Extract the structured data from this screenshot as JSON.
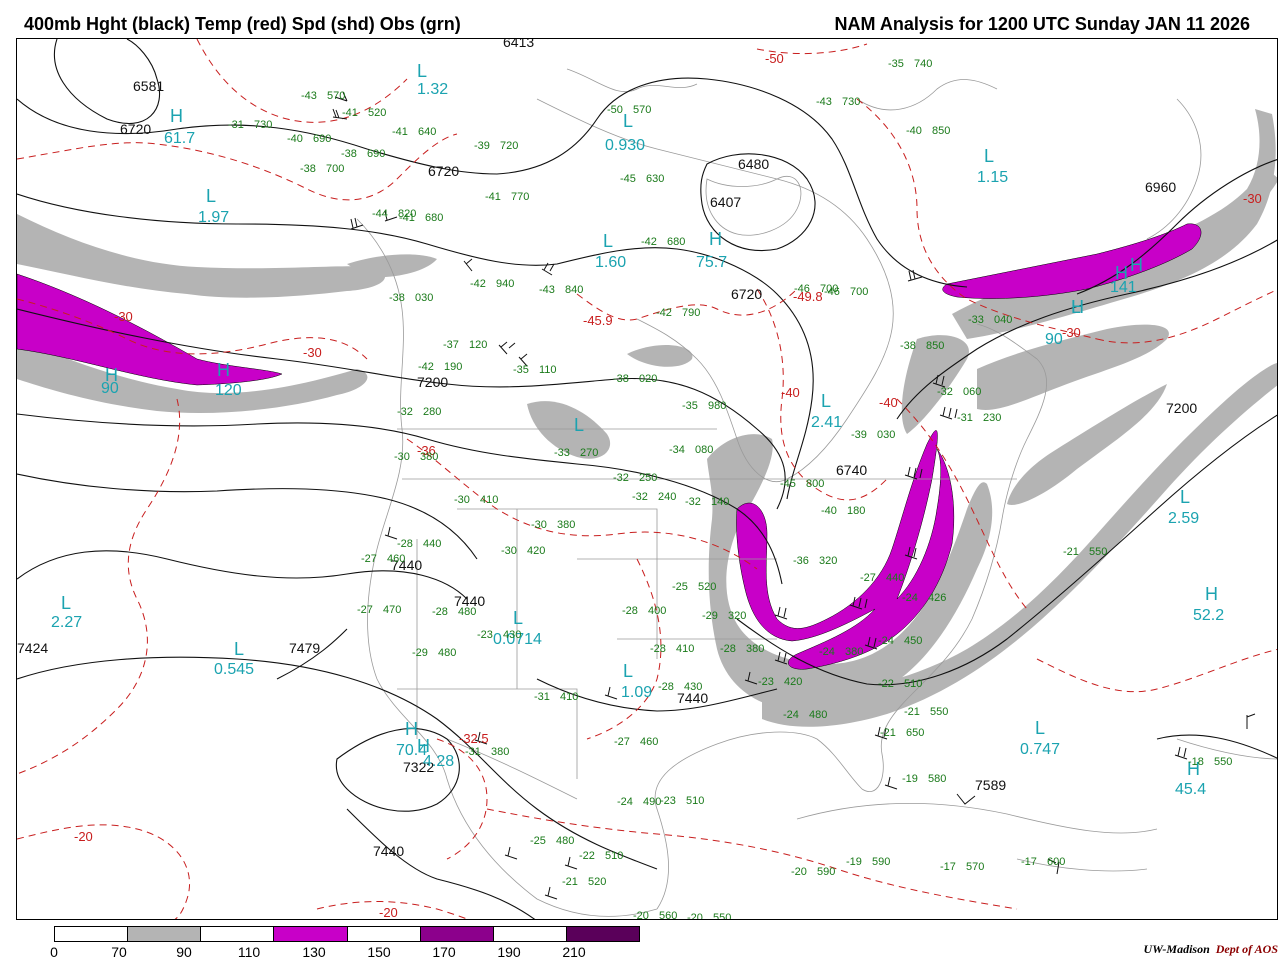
{
  "header": {
    "left_title": "400mb Hght (black) Temp (red) Spd (shd) Obs (grn)",
    "right_title": "NAM Analysis for 1200 UTC Sunday  JAN 11 2026"
  },
  "colors": {
    "height_contour": "#111111",
    "temp_contour": "#c81e1e",
    "obs": "#1a7a1a",
    "extrema": "#1ba3b0",
    "shade_70_90": "#b4b4b4",
    "shade_110_130": "#c800c8",
    "shade_150_170": "#8c008c",
    "shade_190_210": "#5a005a"
  },
  "height_labels": [
    {
      "text": "6413"
    },
    {
      "text": "6581"
    },
    {
      "text": "6720"
    },
    {
      "text": "6720"
    },
    {
      "text": "6480"
    },
    {
      "text": "6407"
    },
    {
      "text": "6720"
    },
    {
      "text": "6960"
    },
    {
      "text": "7200"
    },
    {
      "text": "7200"
    },
    {
      "text": "6740"
    },
    {
      "text": "7440"
    },
    {
      "text": "7440"
    },
    {
      "text": "7424"
    },
    {
      "text": "7479"
    },
    {
      "text": "7322"
    },
    {
      "text": "7440"
    },
    {
      "text": "7440"
    },
    {
      "text": "7589"
    }
  ],
  "temp_labels": [
    {
      "text": "-50"
    },
    {
      "text": "-30"
    },
    {
      "text": "-30"
    },
    {
      "text": "-30"
    },
    {
      "text": "-45.9"
    },
    {
      "text": "-49.8"
    },
    {
      "text": "-40"
    },
    {
      "text": "-40"
    },
    {
      "text": "-30"
    },
    {
      "text": "-36"
    },
    {
      "text": "-32.5"
    },
    {
      "text": "-20"
    },
    {
      "text": "-20"
    }
  ],
  "extrema": [
    {
      "letter": "L",
      "value": "1.32"
    },
    {
      "letter": "H",
      "value": "61.7"
    },
    {
      "letter": "L",
      "value": "1.97"
    },
    {
      "letter": "L",
      "value": "0.930"
    },
    {
      "letter": "L",
      "value": "1.15"
    },
    {
      "letter": "L",
      "value": "1.60"
    },
    {
      "letter": "H",
      "value": "75.7"
    },
    {
      "letter": "H",
      "value": "120"
    },
    {
      "letter": "H",
      "value": "90"
    },
    {
      "letter": "H",
      "value": "90"
    },
    {
      "letter": "L",
      "value": "2.41"
    },
    {
      "letter": "H",
      "value": "141"
    },
    {
      "letter": "L",
      "value": "2.59"
    },
    {
      "letter": "H",
      "value": "52.2"
    },
    {
      "letter": "L",
      "value": "2.27"
    },
    {
      "letter": "L",
      "value": "0.545"
    },
    {
      "letter": "L",
      "value": "0.0714"
    },
    {
      "letter": "L",
      "value": "1.09"
    },
    {
      "letter": "H",
      "value": "70.4"
    },
    {
      "letter": "L",
      "value": "0.747"
    },
    {
      "letter": "H",
      "value": "45.4"
    },
    {
      "letter": "H",
      "value": "4.28"
    },
    {
      "letter": "L",
      "value": ""
    },
    {
      "letter": "H",
      "value": ""
    },
    {
      "letter": "L",
      "value": ""
    }
  ],
  "observations": [
    {
      "t": "-43",
      "h": "570"
    },
    {
      "t": "-41",
      "h": "520"
    },
    {
      "t": "-31",
      "h": "730"
    },
    {
      "t": "-40",
      "h": "690"
    },
    {
      "t": "-41",
      "h": "640"
    },
    {
      "t": "-38",
      "h": "690"
    },
    {
      "t": "-38",
      "h": "700"
    },
    {
      "t": "-39",
      "h": "720"
    },
    {
      "t": "-41",
      "h": "770"
    },
    {
      "t": "-42",
      "h": "680"
    },
    {
      "t": "-50",
      "h": "570"
    },
    {
      "t": "-45",
      "h": "630"
    },
    {
      "t": "-43",
      "h": "730"
    },
    {
      "t": "-40",
      "h": "850"
    },
    {
      "t": "-35",
      "h": "740"
    },
    {
      "t": "-41",
      "h": "680"
    },
    {
      "t": "-44",
      "h": "820"
    },
    {
      "t": "-42",
      "h": "940"
    },
    {
      "t": "-43",
      "h": "840"
    },
    {
      "t": "-38",
      "h": "030"
    },
    {
      "t": "-46",
      "h": "700"
    },
    {
      "t": "-46",
      "h": "700"
    },
    {
      "t": "-42",
      "h": "790"
    },
    {
      "t": "-37",
      "h": "120"
    },
    {
      "t": "-42",
      "h": "190"
    },
    {
      "t": "-35",
      "h": "110"
    },
    {
      "t": "-38",
      "h": "020"
    },
    {
      "t": "-32",
      "h": "280"
    },
    {
      "t": "-30",
      "h": "380"
    },
    {
      "t": "-33",
      "h": "270"
    },
    {
      "t": "-34",
      "h": "080"
    },
    {
      "t": "-35",
      "h": "980"
    },
    {
      "t": "-38",
      "h": "850"
    },
    {
      "t": "-33",
      "h": "040"
    },
    {
      "t": "-32",
      "h": "060"
    },
    {
      "t": "-31",
      "h": "230"
    },
    {
      "t": "-39",
      "h": "030"
    },
    {
      "t": "-30",
      "h": "410"
    },
    {
      "t": "-32",
      "h": "250"
    },
    {
      "t": "-32",
      "h": "240"
    },
    {
      "t": "-32",
      "h": "140"
    },
    {
      "t": "-45",
      "h": "800"
    },
    {
      "t": "-40",
      "h": "180"
    },
    {
      "t": "-30",
      "h": "380"
    },
    {
      "t": "-28",
      "h": "440"
    },
    {
      "t": "-30",
      "h": "420"
    },
    {
      "t": "-27",
      "h": "460"
    },
    {
      "t": "-27",
      "h": "470"
    },
    {
      "t": "-28",
      "h": "480"
    },
    {
      "t": "-23",
      "h": "430"
    },
    {
      "t": "-29",
      "h": "480"
    },
    {
      "t": "-28",
      "h": "400"
    },
    {
      "t": "-28",
      "h": "410"
    },
    {
      "t": "-25",
      "h": "520"
    },
    {
      "t": "-29",
      "h": "320"
    },
    {
      "t": "-28",
      "h": "380"
    },
    {
      "t": "-36",
      "h": "320"
    },
    {
      "t": "-27",
      "h": "440"
    },
    {
      "t": "-24",
      "h": "426"
    },
    {
      "t": "-24",
      "h": "450"
    },
    {
      "t": "-24",
      "h": "380"
    },
    {
      "t": "-31",
      "h": "410"
    },
    {
      "t": "-28",
      "h": "430"
    },
    {
      "t": "-23",
      "h": "420"
    },
    {
      "t": "-24",
      "h": "480"
    },
    {
      "t": "-22",
      "h": "510"
    },
    {
      "t": "-21",
      "h": "550"
    },
    {
      "t": "-21",
      "h": "550"
    },
    {
      "t": "-21",
      "h": "650"
    },
    {
      "t": "-27",
      "h": "460"
    },
    {
      "t": "-31",
      "h": "380"
    },
    {
      "t": "-24",
      "h": "490"
    },
    {
      "t": "-23",
      "h": "510"
    },
    {
      "t": "-19",
      "h": "580"
    },
    {
      "t": "-25",
      "h": "480"
    },
    {
      "t": "-22",
      "h": "510"
    },
    {
      "t": "-21",
      "h": "520"
    },
    {
      "t": "-20",
      "h": "590"
    },
    {
      "t": "-19",
      "h": "590"
    },
    {
      "t": "-17",
      "h": "570"
    },
    {
      "t": "-17",
      "h": "600"
    },
    {
      "t": "-20",
      "h": "560"
    },
    {
      "t": "-20",
      "h": "550"
    },
    {
      "t": "-18",
      "h": "550"
    }
  ],
  "legend": {
    "ticks": [
      "0",
      "70",
      "90",
      "110",
      "130",
      "150",
      "170",
      "190",
      "210"
    ]
  },
  "footer": {
    "credit": "UW-Madison",
    "dept": "Dept of AOS"
  }
}
